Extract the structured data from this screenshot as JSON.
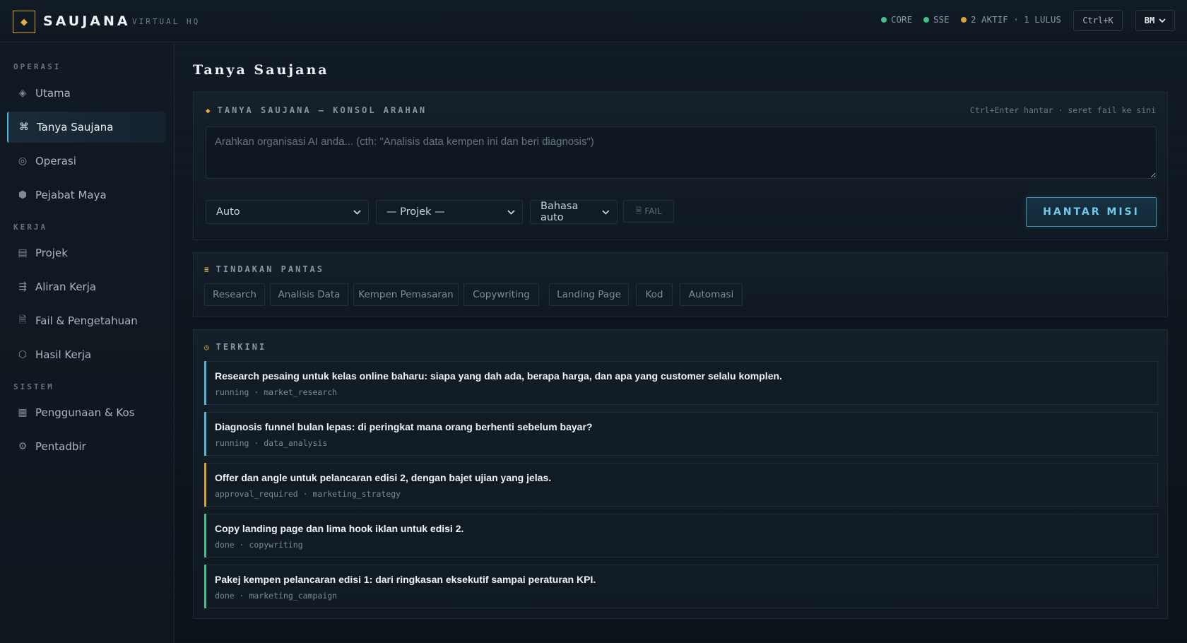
{
  "header": {
    "brand": "SAUJANA",
    "brand_sub": "VIRTUAL HQ",
    "status": {
      "core": "CORE",
      "sse": "SSE",
      "active": "2 AKTIF · 1 LULUS"
    },
    "shortcut": "Ctrl+K",
    "language": "BM"
  },
  "sidebar": {
    "sections": [
      "OPERASI",
      "KERJA",
      "SISTEM"
    ],
    "items": [
      {
        "label": "Utama",
        "icon": "diamond-icon"
      },
      {
        "label": "Tanya Saujana",
        "icon": "command-icon"
      },
      {
        "label": "Operasi",
        "icon": "target-icon"
      },
      {
        "label": "Pejabat Maya",
        "icon": "hexagon-icon"
      },
      {
        "label": "Projek",
        "icon": "box-icon"
      },
      {
        "label": "Aliran Kerja",
        "icon": "workflow-icon"
      },
      {
        "label": "Fail & Pengetahuan",
        "icon": "file-icon"
      },
      {
        "label": "Hasil Kerja",
        "icon": "circle-icon"
      },
      {
        "label": "Penggunaan & Kos",
        "icon": "grid-icon"
      },
      {
        "label": "Pentadbir",
        "icon": "gear-icon"
      }
    ]
  },
  "main": {
    "title": "Tanya Saujana",
    "console": {
      "heading": "TANYA SAUJANA — KONSOL ARAHAN",
      "hint": "Ctrl+Enter hantar · seret fail ke sini",
      "placeholder": "Arahkan organisasi AI anda... (cth: \"Analisis data kempen ini dan beri diagnosis\")",
      "mode_select": "Auto",
      "project_select": "— Projek —",
      "language_select": "Bahasa auto",
      "file_button": "FAIL",
      "send_button": "HANTAR MISI"
    },
    "quick_actions": {
      "heading": "TINDAKAN PANTAS",
      "chips": [
        "Research",
        "Analisis Data",
        "Kempen Pemasaran",
        "Copywriting",
        "Landing Page",
        "Kod",
        "Automasi"
      ]
    },
    "recent": {
      "heading": "TERKINI",
      "tasks": [
        {
          "title": "Research pesaing untuk kelas online baharu: siapa yang dah ada, berapa harga, dan apa yang customer selalu komplen.",
          "status": "running",
          "type": "market_research",
          "color": "#4fb7d6"
        },
        {
          "title": "Diagnosis funnel bulan lepas: di peringkat mana orang berhenti sebelum bayar?",
          "status": "running",
          "type": "data_analysis",
          "color": "#4fb7d6"
        },
        {
          "title": "Offer dan angle untuk pelancaran edisi 2, dengan bajet ujian yang jelas.",
          "status": "approval_required",
          "type": "marketing_strategy",
          "color": "#d9a13a"
        },
        {
          "title": "Copy landing page dan lima hook iklan untuk edisi 2.",
          "status": "done",
          "type": "copywriting",
          "color": "#3fc08a"
        },
        {
          "title": "Pakej kempen pelancaran edisi 1: dari ringkasan eksekutif sampai peraturan KPI.",
          "status": "done",
          "type": "marketing_campaign",
          "color": "#3fc08a"
        }
      ]
    }
  },
  "colors": {
    "accent_gold": "#e0b040",
    "accent_cyan": "#4fb7d6",
    "status_green": "#3fc08a",
    "status_amber": "#d9a13a"
  }
}
